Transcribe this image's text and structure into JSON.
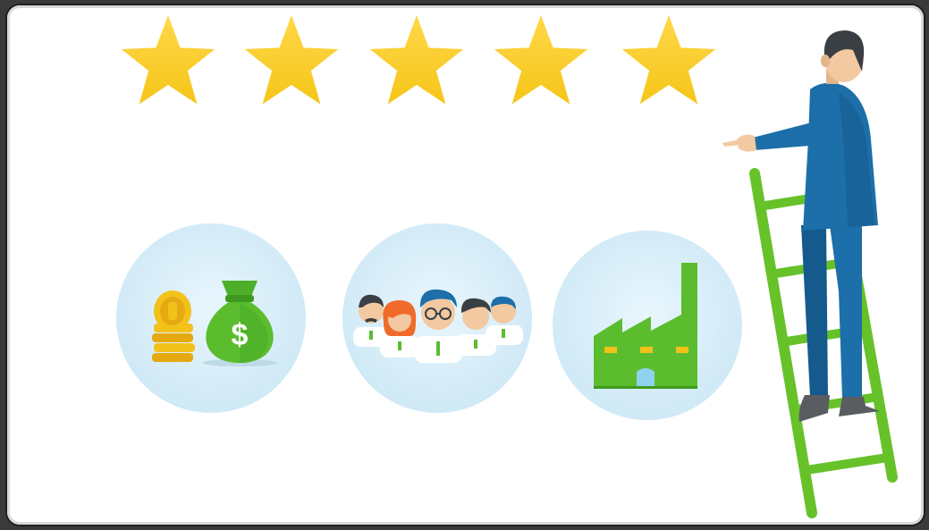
{
  "scene": {
    "rating": {
      "stars_filled": 5,
      "stars_total": 5,
      "star_color": "#F5C518",
      "star_highlight": "#FFD84A"
    },
    "colors": {
      "circle_fill": "#D7EEF9",
      "green": "#5BBD2E",
      "green_dark": "#3E9A1F",
      "ladder": "#67C22A",
      "suit": "#1C6FA8",
      "suit_dark": "#155A8C",
      "skin": "#F2C9A0",
      "hair": "#3A3F44",
      "coin": "#F2C21B"
    },
    "icons": [
      {
        "name": "money-icon",
        "symbol": "$"
      },
      {
        "name": "team-icon"
      },
      {
        "name": "factory-icon"
      }
    ]
  }
}
